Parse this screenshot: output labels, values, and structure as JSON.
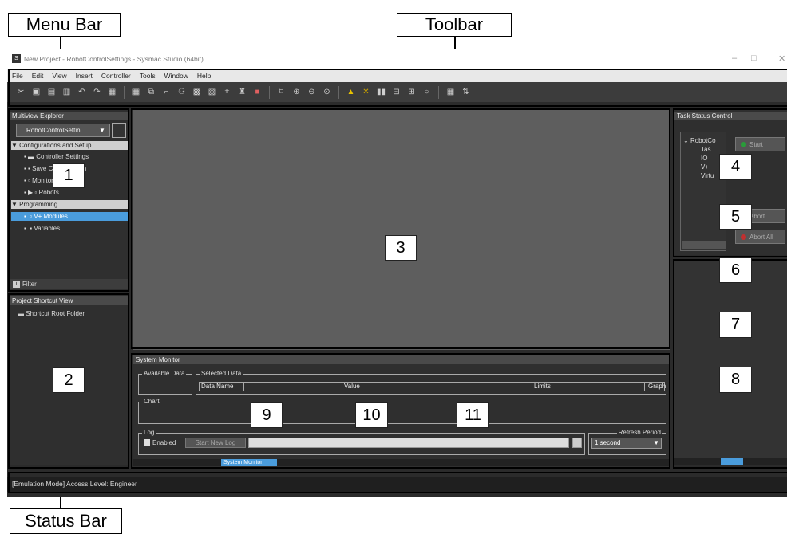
{
  "callouts": {
    "menu_bar": "Menu Bar",
    "toolbar": "Toolbar",
    "status_bar": "Status Bar",
    "numbers": [
      "1",
      "2",
      "3",
      "4",
      "5",
      "6",
      "7",
      "8",
      "9",
      "10",
      "11"
    ]
  },
  "window": {
    "title": "New Project - RobotControlSettings - Sysmac Studio (64bit)",
    "controls": [
      "–",
      "□",
      "✕"
    ]
  },
  "menu": [
    "File",
    "Edit",
    "View",
    "Insert",
    "Controller",
    "Tools",
    "Window",
    "Help"
  ],
  "multiview": {
    "title": "Multiview Explorer",
    "device": "RobotControlSettin",
    "tree": {
      "config": "Configurations and Setup",
      "item1": "Controller Settings",
      "item2": "Save Configuration",
      "item3": "Monitor Window",
      "robots": "Robots",
      "programming": "Programming",
      "vplus": "V+ Modules",
      "variables": "Variables"
    },
    "filter": "Filter"
  },
  "shortcut": {
    "title": "Project Shortcut View",
    "root": "Shortcut Root Folder"
  },
  "task_status": {
    "title": "Task Status Control",
    "robot": "RobotCo",
    "items": [
      "Tas",
      "IO",
      "V+",
      "Virtu"
    ],
    "start": "Start",
    "abort": "Abort",
    "abort_all": "Abort All"
  },
  "system_monitor": {
    "title": "System Monitor",
    "available": "Available Data",
    "selected": "Selected Data",
    "cols": [
      "Data Name",
      "Value",
      "Limits",
      "Graph"
    ],
    "chart": "Chart",
    "log": "Log",
    "enabled": "Enabled",
    "start_log": "Start New Log",
    "refresh": "Refresh Period",
    "refresh_value": "1 second",
    "active_tab": "System Monitor"
  },
  "status_bar": "[Emulation Mode] Access Level: Engineer",
  "colors": {
    "accent": "#4a9cdc",
    "dark_bg": "#2b2b2b",
    "workspace": "#5e5e5e"
  }
}
